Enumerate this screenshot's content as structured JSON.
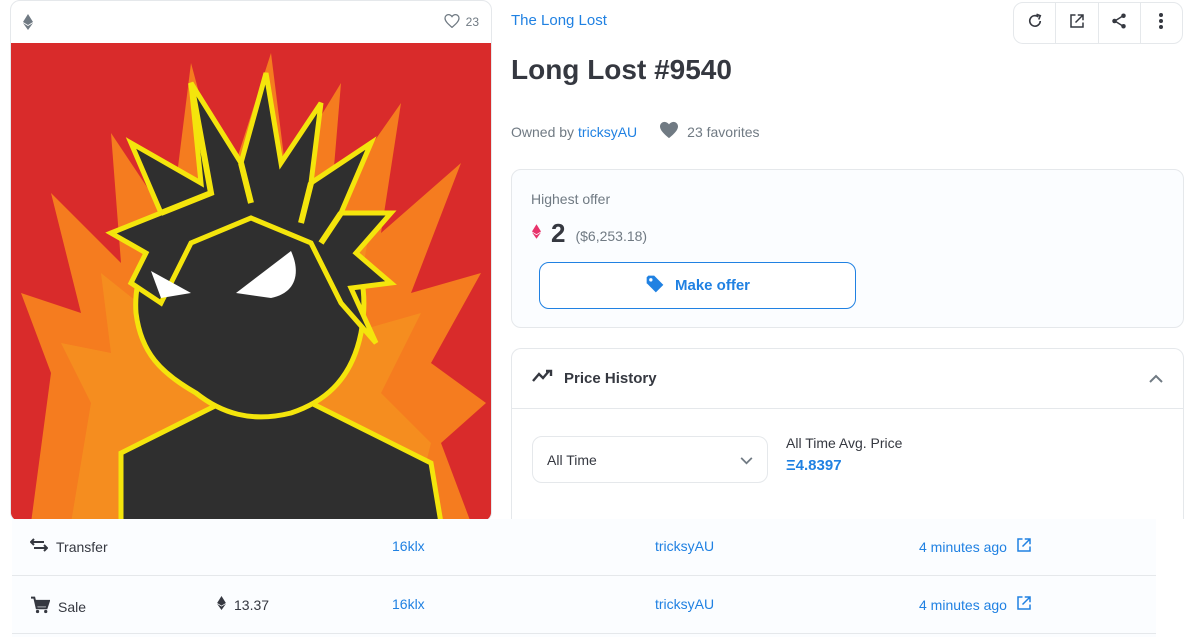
{
  "nft_card": {
    "favorites_count": "23"
  },
  "collection": {
    "name": "The Long Lost"
  },
  "item": {
    "title": "Long Lost #9540"
  },
  "owner": {
    "prefix": "Owned by",
    "name": "tricksyAU",
    "favorites": "23 favorites"
  },
  "toolbar": {
    "icons": [
      "refresh-icon",
      "external-link-icon",
      "share-icon",
      "more-vertical-icon"
    ]
  },
  "offer": {
    "label": "Highest offer",
    "amount": "2",
    "usd": "($6,253.18)",
    "button_label": "Make offer"
  },
  "price_history": {
    "title": "Price History",
    "period": "All Time",
    "avg_label": "All Time Avg. Price",
    "avg_value": "Ξ4.8397"
  },
  "activity": [
    {
      "event": "Transfer",
      "price": "",
      "from": "16klx",
      "to": "tricksyAU",
      "time": "4 minutes ago"
    },
    {
      "event": "Sale",
      "price": "13.37",
      "from": "16klx",
      "to": "tricksyAU",
      "time": "4 minutes ago"
    }
  ],
  "colors": {
    "accent": "#2081e2",
    "text": "#353840",
    "muted": "#707a83",
    "border": "#e5e8eb",
    "art_background": "#d92b2b",
    "art_flame": "#f57c1f",
    "art_hair": "#f4e50c",
    "art_body": "#2f2f2f",
    "eth_pink": "#e8336b"
  }
}
